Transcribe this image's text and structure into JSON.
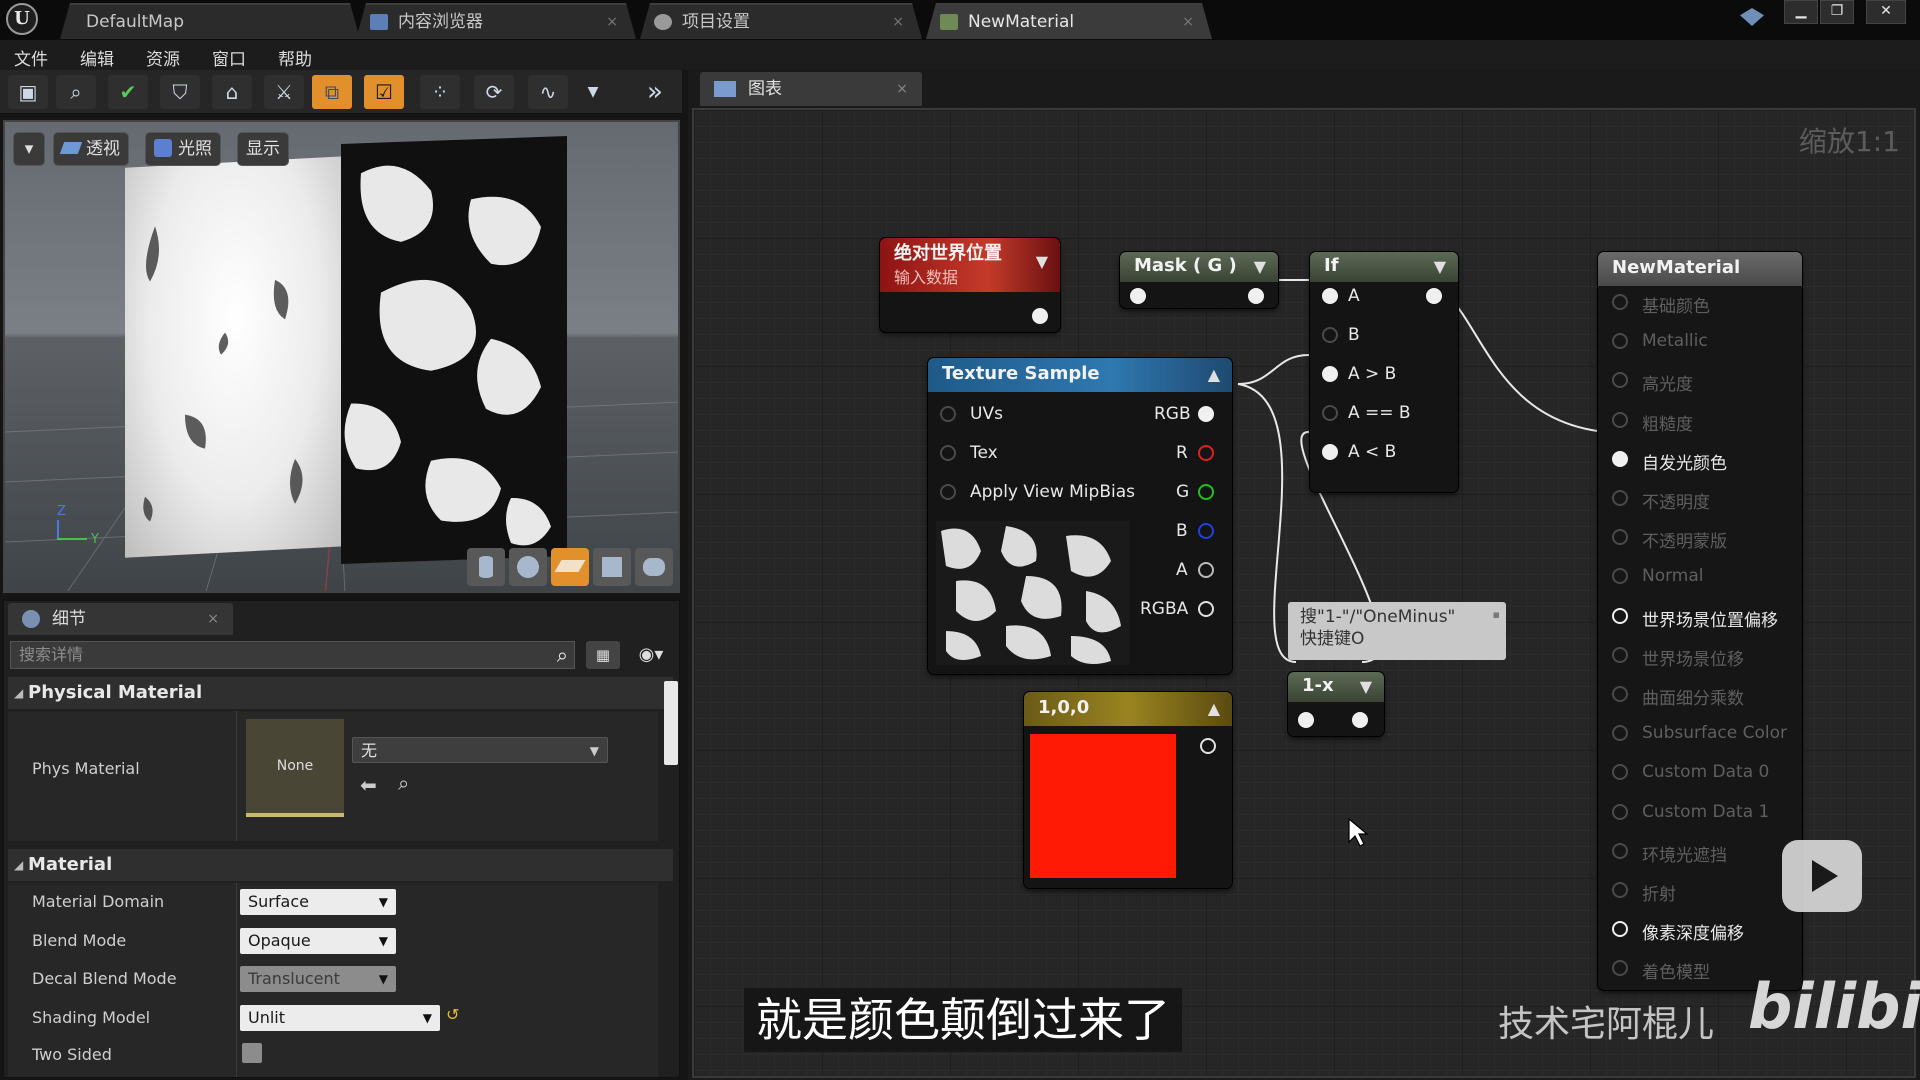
{
  "tabs": [
    {
      "label": "DefaultMap"
    },
    {
      "label": "内容浏览器"
    },
    {
      "label": "项目设置"
    },
    {
      "label": "NewMaterial"
    }
  ],
  "menu": [
    "文件",
    "编辑",
    "资源",
    "窗口",
    "帮助"
  ],
  "viewport": {
    "dropdown_glyph": "▾",
    "perspective_label": "透视",
    "lighting_label": "光照",
    "show_label": "显示",
    "axis_z": "Z",
    "axis_y": "Y"
  },
  "details": {
    "tab_label": "细节",
    "search_placeholder": "搜索详情",
    "physical_material_header": "Physical Material",
    "phys_material_label": "Phys Material",
    "phys_material_thumb": "None",
    "phys_material_value": "无",
    "material_header": "Material",
    "props": [
      {
        "label": "Material Domain",
        "value": "Surface"
      },
      {
        "label": "Blend Mode",
        "value": "Opaque"
      },
      {
        "label": "Decal Blend Mode",
        "value": "Translucent"
      },
      {
        "label": "Shading Model",
        "value": "Unlit"
      },
      {
        "label": "Two Sided",
        "value": ""
      }
    ]
  },
  "graph": {
    "tab_label": "图表",
    "zoom_label": "缩放1:1",
    "nodes": {
      "world_pos": {
        "title": "绝对世界位置",
        "subtitle": "输入数据"
      },
      "mask": {
        "title": "Mask ( G )"
      },
      "if": {
        "title": "If",
        "pins": [
          "A",
          "B",
          "A > B",
          "A == B",
          "A < B"
        ]
      },
      "texture": {
        "title": "Texture Sample",
        "inputs": [
          "UVs",
          "Tex",
          "Apply View MipBias"
        ],
        "outputs": [
          "RGB",
          "R",
          "G",
          "B",
          "A",
          "RGBA"
        ]
      },
      "constant": {
        "title": "1,0,0",
        "color": "#ff1a05"
      },
      "one_minus": {
        "title": "1-x"
      },
      "result": {
        "title": "NewMaterial",
        "pins": [
          {
            "label": "基础颜色",
            "active": false
          },
          {
            "label": "Metallic",
            "active": false
          },
          {
            "label": "高光度",
            "active": false
          },
          {
            "label": "粗糙度",
            "active": false
          },
          {
            "label": "自发光颜色",
            "active": true
          },
          {
            "label": "不透明度",
            "active": false
          },
          {
            "label": "不透明蒙版",
            "active": false
          },
          {
            "label": "Normal",
            "active": false
          },
          {
            "label": "世界场景位置偏移",
            "active": true
          },
          {
            "label": "世界场景位移",
            "active": false
          },
          {
            "label": "曲面细分乘数",
            "active": false
          },
          {
            "label": "Subsurface Color",
            "active": false
          },
          {
            "label": "Custom Data 0",
            "active": false
          },
          {
            "label": "Custom Data 1",
            "active": false
          },
          {
            "label": "环境光遮挡",
            "active": false
          },
          {
            "label": "折射",
            "active": false
          },
          {
            "label": "像素深度偏移",
            "active": true
          },
          {
            "label": "着色模型",
            "active": false
          }
        ]
      }
    },
    "tooltip": {
      "line1": "搜\"1-\"/\"OneMinus\"",
      "line2": "快捷键O"
    }
  },
  "overlay": {
    "subtitle": "就是颜色颠倒过来了",
    "watermark": "技术宅阿棍儿",
    "logo": "bilibili"
  },
  "colors": {
    "accent": "#e2902b",
    "red_pin": "#e02020",
    "green_pin": "#20c020",
    "blue_pin": "#2040e0"
  }
}
